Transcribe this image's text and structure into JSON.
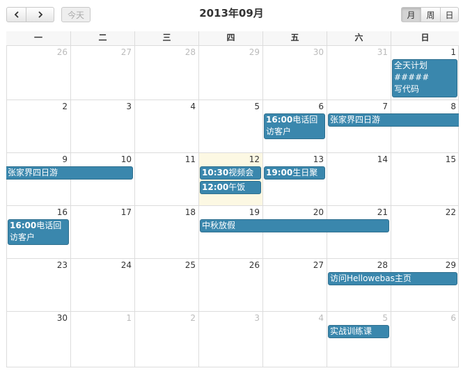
{
  "toolbar": {
    "title": "2013年09月",
    "today_label": "今天",
    "views": [
      {
        "label": "月",
        "active": true
      },
      {
        "label": "周",
        "active": false
      },
      {
        "label": "日",
        "active": false
      }
    ]
  },
  "weekdays": [
    "一",
    "二",
    "三",
    "四",
    "五",
    "六",
    "日"
  ],
  "weeks": [
    [
      {
        "d": "26",
        "other": true
      },
      {
        "d": "27",
        "other": true
      },
      {
        "d": "28",
        "other": true
      },
      {
        "d": "29",
        "other": true
      },
      {
        "d": "30",
        "other": true
      },
      {
        "d": "31",
        "other": true
      },
      {
        "d": "1"
      }
    ],
    [
      {
        "d": "2"
      },
      {
        "d": "3"
      },
      {
        "d": "4"
      },
      {
        "d": "5"
      },
      {
        "d": "6"
      },
      {
        "d": "7"
      },
      {
        "d": "8"
      }
    ],
    [
      {
        "d": "9"
      },
      {
        "d": "10"
      },
      {
        "d": "11"
      },
      {
        "d": "12",
        "today": true
      },
      {
        "d": "13"
      },
      {
        "d": "14"
      },
      {
        "d": "15"
      }
    ],
    [
      {
        "d": "16"
      },
      {
        "d": "17"
      },
      {
        "d": "18"
      },
      {
        "d": "19"
      },
      {
        "d": "20"
      },
      {
        "d": "21"
      },
      {
        "d": "22"
      }
    ],
    [
      {
        "d": "23"
      },
      {
        "d": "24"
      },
      {
        "d": "25"
      },
      {
        "d": "26"
      },
      {
        "d": "27"
      },
      {
        "d": "28"
      },
      {
        "d": "29"
      }
    ],
    [
      {
        "d": "30"
      },
      {
        "d": "1",
        "other": true
      },
      {
        "d": "2",
        "other": true
      },
      {
        "d": "3",
        "other": true
      },
      {
        "d": "4",
        "other": true
      },
      {
        "d": "5",
        "other": true
      },
      {
        "d": "6",
        "other": true
      }
    ]
  ],
  "events": [
    {
      "time": "",
      "title": "全天计划\n#####\n写代码",
      "week": 0,
      "start": 6,
      "span": 1,
      "slot": 0,
      "lines": 3
    },
    {
      "time": "16:00",
      "title": "电话回访客户",
      "week": 1,
      "start": 4,
      "span": 1,
      "slot": 0,
      "lines": 2
    },
    {
      "time": "",
      "title": "张家界四日游",
      "week": 1,
      "start": 5,
      "span": 2,
      "slot": 0,
      "lines": 1,
      "cont_right": true
    },
    {
      "time": "",
      "title": "张家界四日游",
      "week": 2,
      "start": 0,
      "span": 2,
      "slot": 0,
      "lines": 1,
      "cont_left": true
    },
    {
      "time": "10:30",
      "title": "视频会议",
      "week": 2,
      "start": 3,
      "span": 1,
      "slot": 0,
      "lines": 1
    },
    {
      "time": "19:00",
      "title": "生日聚会",
      "week": 2,
      "start": 4,
      "span": 1,
      "slot": 0,
      "lines": 1
    },
    {
      "time": "12:00",
      "title": "午饭",
      "week": 2,
      "start": 3,
      "span": 1,
      "slot": 1,
      "lines": 1
    },
    {
      "time": "16:00",
      "title": "电话回访客户",
      "week": 3,
      "start": 0,
      "span": 1,
      "slot": 0,
      "lines": 2
    },
    {
      "time": "",
      "title": "中秋放假",
      "week": 3,
      "start": 3,
      "span": 3,
      "slot": 0,
      "lines": 1
    },
    {
      "time": "",
      "title": "访问Hellowebas主页",
      "week": 4,
      "start": 5,
      "span": 2,
      "slot": 0,
      "lines": 1
    },
    {
      "time": "",
      "title": "实战训练课",
      "week": 5,
      "start": 5,
      "span": 1,
      "slot": 0,
      "lines": 1
    }
  ]
}
